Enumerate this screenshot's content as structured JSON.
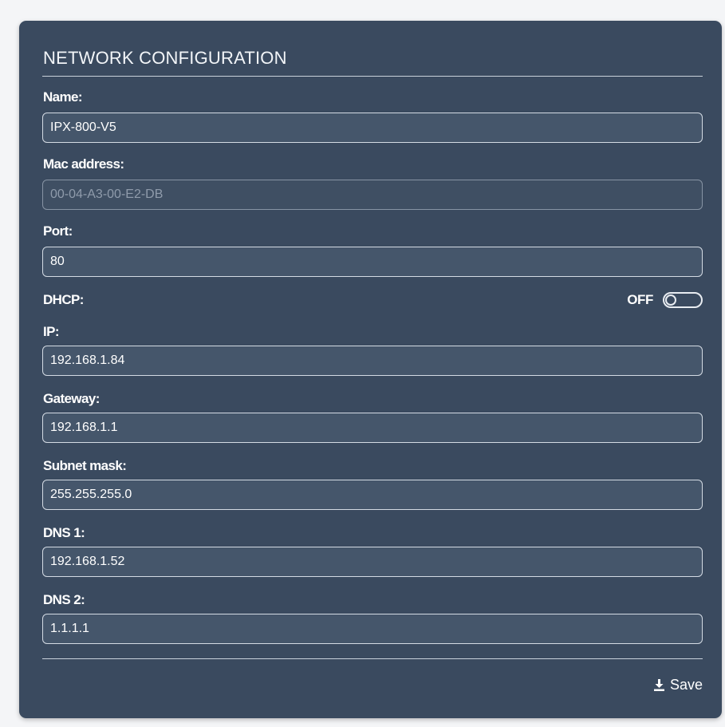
{
  "panel": {
    "title": "NETWORK CONFIGURATION"
  },
  "fields": {
    "name": {
      "label": "Name:",
      "value": "IPX-800-V5"
    },
    "mac": {
      "label": "Mac address:",
      "value": "00-04-A3-00-E2-DB"
    },
    "port": {
      "label": "Port:",
      "value": "80"
    },
    "dhcp": {
      "label": "DHCP:",
      "state": "OFF"
    },
    "ip": {
      "label": "IP:",
      "value": "192.168.1.84"
    },
    "gateway": {
      "label": "Gateway:",
      "value": "192.168.1.1"
    },
    "subnet": {
      "label": "Subnet mask:",
      "value": "255.255.255.0"
    },
    "dns1": {
      "label": "DNS 1:",
      "value": "192.168.1.52"
    },
    "dns2": {
      "label": "DNS 2:",
      "value": "1.1.1.1"
    }
  },
  "actions": {
    "save_label": "Save",
    "save_icon": "download-icon"
  },
  "colors": {
    "panel_bg": "#3a4a5f",
    "field_bg": "#45566b",
    "text": "#ffffff"
  }
}
